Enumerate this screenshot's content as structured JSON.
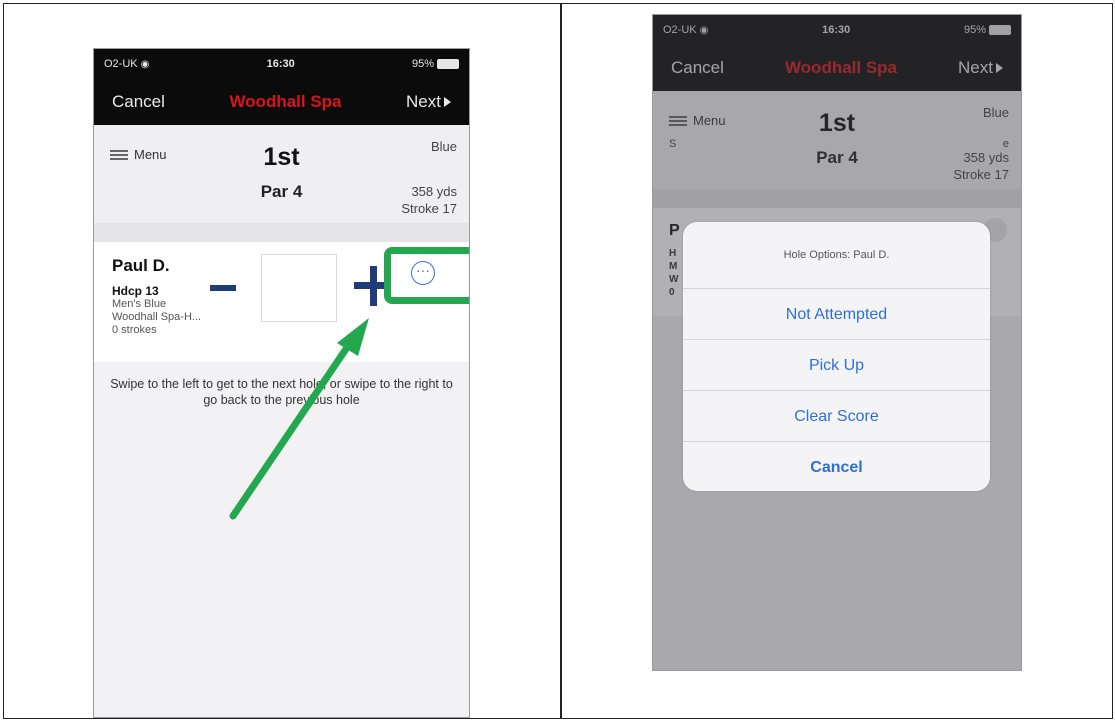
{
  "status_bar": {
    "carrier": "O2-UK",
    "time": "16:30",
    "battery": "95%"
  },
  "nav": {
    "cancel_label": "Cancel",
    "title": "Woodhall Spa",
    "next_label": "Next",
    "title_color": "#d8151b"
  },
  "hole": {
    "menu_label": "Menu",
    "number": "1st",
    "par": "Par 4",
    "tee": "Blue",
    "yards": "358 yds",
    "stroke": "Stroke 17"
  },
  "player": {
    "name": "Paul D.",
    "handicap": "Hdcp 13",
    "tee_name": "Men's Blue",
    "course": "Woodhall Spa-H...",
    "strokes": "0 strokes",
    "options_glyph": "···"
  },
  "hint": "Swipe to the left to get to the next hole, or swipe to the right to go back to the previous hole",
  "action_sheet": {
    "title": "Hole Options: Paul D.",
    "options": [
      "Not Attempted",
      "Pick Up",
      "Clear Score"
    ],
    "cancel_label": "Cancel"
  },
  "right_background": {
    "player_initial": "P",
    "swipe_start": "S",
    "swipe_end": "e"
  },
  "colors": {
    "highlight_green": "#23a84f",
    "button_blue": "#203c78",
    "link_blue": "#2f6fd6"
  }
}
